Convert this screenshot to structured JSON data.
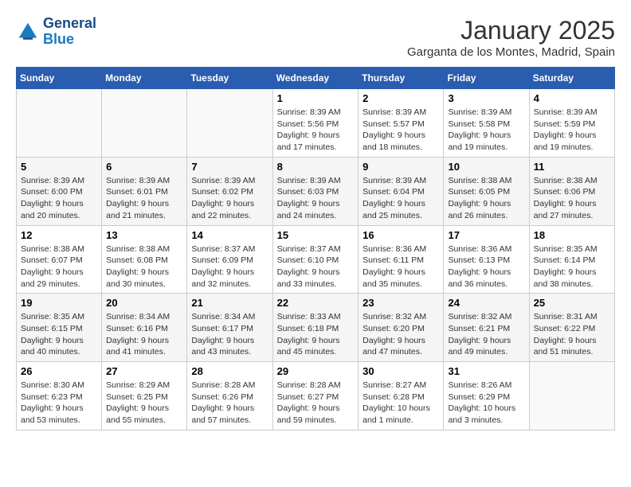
{
  "header": {
    "logo_line1": "General",
    "logo_line2": "Blue",
    "month": "January 2025",
    "location": "Garganta de los Montes, Madrid, Spain"
  },
  "weekdays": [
    "Sunday",
    "Monday",
    "Tuesday",
    "Wednesday",
    "Thursday",
    "Friday",
    "Saturday"
  ],
  "weeks": [
    [
      {
        "day": "",
        "info": ""
      },
      {
        "day": "",
        "info": ""
      },
      {
        "day": "",
        "info": ""
      },
      {
        "day": "1",
        "info": "Sunrise: 8:39 AM\nSunset: 5:56 PM\nDaylight: 9 hours\nand 17 minutes."
      },
      {
        "day": "2",
        "info": "Sunrise: 8:39 AM\nSunset: 5:57 PM\nDaylight: 9 hours\nand 18 minutes."
      },
      {
        "day": "3",
        "info": "Sunrise: 8:39 AM\nSunset: 5:58 PM\nDaylight: 9 hours\nand 19 minutes."
      },
      {
        "day": "4",
        "info": "Sunrise: 8:39 AM\nSunset: 5:59 PM\nDaylight: 9 hours\nand 19 minutes."
      }
    ],
    [
      {
        "day": "5",
        "info": "Sunrise: 8:39 AM\nSunset: 6:00 PM\nDaylight: 9 hours\nand 20 minutes."
      },
      {
        "day": "6",
        "info": "Sunrise: 8:39 AM\nSunset: 6:01 PM\nDaylight: 9 hours\nand 21 minutes."
      },
      {
        "day": "7",
        "info": "Sunrise: 8:39 AM\nSunset: 6:02 PM\nDaylight: 9 hours\nand 22 minutes."
      },
      {
        "day": "8",
        "info": "Sunrise: 8:39 AM\nSunset: 6:03 PM\nDaylight: 9 hours\nand 24 minutes."
      },
      {
        "day": "9",
        "info": "Sunrise: 8:39 AM\nSunset: 6:04 PM\nDaylight: 9 hours\nand 25 minutes."
      },
      {
        "day": "10",
        "info": "Sunrise: 8:38 AM\nSunset: 6:05 PM\nDaylight: 9 hours\nand 26 minutes."
      },
      {
        "day": "11",
        "info": "Sunrise: 8:38 AM\nSunset: 6:06 PM\nDaylight: 9 hours\nand 27 minutes."
      }
    ],
    [
      {
        "day": "12",
        "info": "Sunrise: 8:38 AM\nSunset: 6:07 PM\nDaylight: 9 hours\nand 29 minutes."
      },
      {
        "day": "13",
        "info": "Sunrise: 8:38 AM\nSunset: 6:08 PM\nDaylight: 9 hours\nand 30 minutes."
      },
      {
        "day": "14",
        "info": "Sunrise: 8:37 AM\nSunset: 6:09 PM\nDaylight: 9 hours\nand 32 minutes."
      },
      {
        "day": "15",
        "info": "Sunrise: 8:37 AM\nSunset: 6:10 PM\nDaylight: 9 hours\nand 33 minutes."
      },
      {
        "day": "16",
        "info": "Sunrise: 8:36 AM\nSunset: 6:11 PM\nDaylight: 9 hours\nand 35 minutes."
      },
      {
        "day": "17",
        "info": "Sunrise: 8:36 AM\nSunset: 6:13 PM\nDaylight: 9 hours\nand 36 minutes."
      },
      {
        "day": "18",
        "info": "Sunrise: 8:35 AM\nSunset: 6:14 PM\nDaylight: 9 hours\nand 38 minutes."
      }
    ],
    [
      {
        "day": "19",
        "info": "Sunrise: 8:35 AM\nSunset: 6:15 PM\nDaylight: 9 hours\nand 40 minutes."
      },
      {
        "day": "20",
        "info": "Sunrise: 8:34 AM\nSunset: 6:16 PM\nDaylight: 9 hours\nand 41 minutes."
      },
      {
        "day": "21",
        "info": "Sunrise: 8:34 AM\nSunset: 6:17 PM\nDaylight: 9 hours\nand 43 minutes."
      },
      {
        "day": "22",
        "info": "Sunrise: 8:33 AM\nSunset: 6:18 PM\nDaylight: 9 hours\nand 45 minutes."
      },
      {
        "day": "23",
        "info": "Sunrise: 8:32 AM\nSunset: 6:20 PM\nDaylight: 9 hours\nand 47 minutes."
      },
      {
        "day": "24",
        "info": "Sunrise: 8:32 AM\nSunset: 6:21 PM\nDaylight: 9 hours\nand 49 minutes."
      },
      {
        "day": "25",
        "info": "Sunrise: 8:31 AM\nSunset: 6:22 PM\nDaylight: 9 hours\nand 51 minutes."
      }
    ],
    [
      {
        "day": "26",
        "info": "Sunrise: 8:30 AM\nSunset: 6:23 PM\nDaylight: 9 hours\nand 53 minutes."
      },
      {
        "day": "27",
        "info": "Sunrise: 8:29 AM\nSunset: 6:25 PM\nDaylight: 9 hours\nand 55 minutes."
      },
      {
        "day": "28",
        "info": "Sunrise: 8:28 AM\nSunset: 6:26 PM\nDaylight: 9 hours\nand 57 minutes."
      },
      {
        "day": "29",
        "info": "Sunrise: 8:28 AM\nSunset: 6:27 PM\nDaylight: 9 hours\nand 59 minutes."
      },
      {
        "day": "30",
        "info": "Sunrise: 8:27 AM\nSunset: 6:28 PM\nDaylight: 10 hours\nand 1 minute."
      },
      {
        "day": "31",
        "info": "Sunrise: 8:26 AM\nSunset: 6:29 PM\nDaylight: 10 hours\nand 3 minutes."
      },
      {
        "day": "",
        "info": ""
      }
    ]
  ]
}
